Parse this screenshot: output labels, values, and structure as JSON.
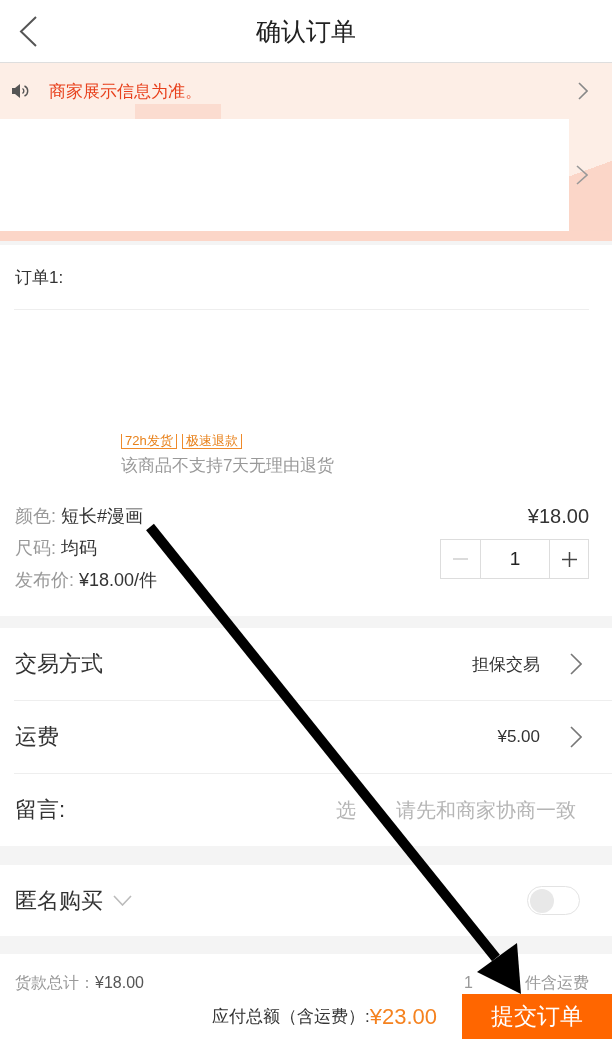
{
  "header": {
    "title": "确认订单"
  },
  "notice": {
    "text": "商家展示信息为准。"
  },
  "order": {
    "label": "订单1:",
    "tags": [
      "72h发货",
      "极速退款"
    ],
    "return_note": "该商品不支持7天无理由退货",
    "specs": [
      {
        "label": "颜色:",
        "value": "短长#漫画"
      },
      {
        "label": "尺码:",
        "value": "均码"
      },
      {
        "label": "发布价:",
        "value": "¥18.00/件"
      }
    ],
    "price": "¥18.00",
    "quantity": {
      "value": "1",
      "minus_disabled": true
    }
  },
  "options": [
    {
      "kind": "link",
      "label": "交易方式",
      "value": "担保交易"
    },
    {
      "kind": "link",
      "label": "运费",
      "value": "¥5.00"
    },
    {
      "kind": "input",
      "label": "留言:",
      "placeholder": "选　　请先和商家协商一致"
    }
  ],
  "anonymous": {
    "label": "匿名购买",
    "on": false
  },
  "summary": {
    "goods_total_label": "货款总计：",
    "goods_total": "¥18.00",
    "count_prefix": "1",
    "count_suffix": "件含运费",
    "payable_label": "应付总额（含运费）:",
    "payable": "¥23.00",
    "submit": "提交订单"
  }
}
